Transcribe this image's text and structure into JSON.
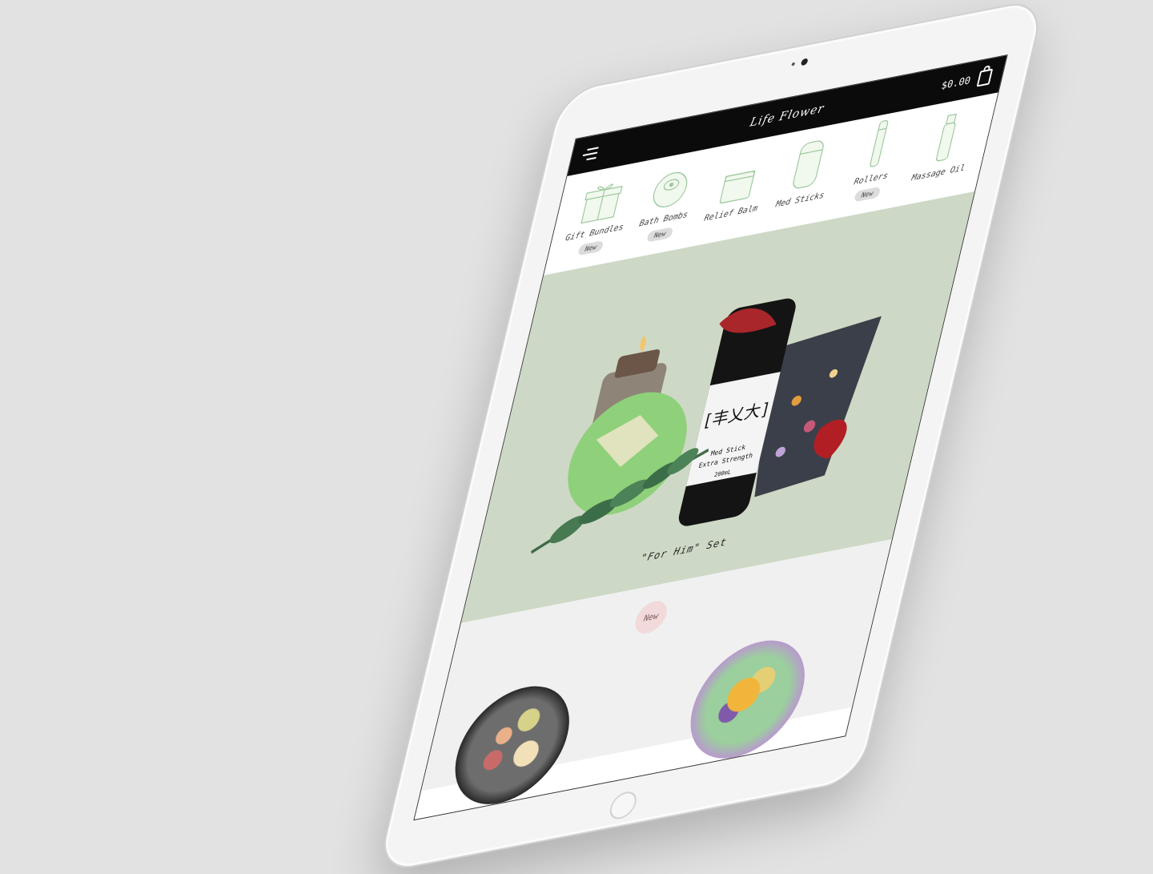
{
  "app": {
    "brand": "Life Flower",
    "cart_total": "$0.00"
  },
  "categories": [
    {
      "label": "Gift Bundles",
      "badge": "New",
      "icon": "gift-box-icon"
    },
    {
      "label": "Bath Bombs",
      "badge": "New",
      "icon": "bath-bomb-icon"
    },
    {
      "label": "Relief Balm",
      "badge": "",
      "icon": "balm-jar-icon"
    },
    {
      "label": "Med Sticks",
      "badge": "",
      "icon": "med-stick-icon"
    },
    {
      "label": "Rollers",
      "badge": "New",
      "icon": "roller-icon"
    },
    {
      "label": "Massage Oil",
      "badge": "",
      "icon": "oil-bottle-icon"
    }
  ],
  "hero": {
    "caption": "\"For Him\" Set",
    "product_label_line1": "Med Stick",
    "product_label_line2": "Extra Strength",
    "product_label_volume": "200mL",
    "background": "#cdd9c6"
  },
  "new_section": {
    "badge": "New"
  },
  "colors": {
    "topbar": "#0b0b0b",
    "hero_bg": "#cdd9c6",
    "icon_stroke": "#9bc79b",
    "new_badge_bg": "#f2d9da"
  }
}
